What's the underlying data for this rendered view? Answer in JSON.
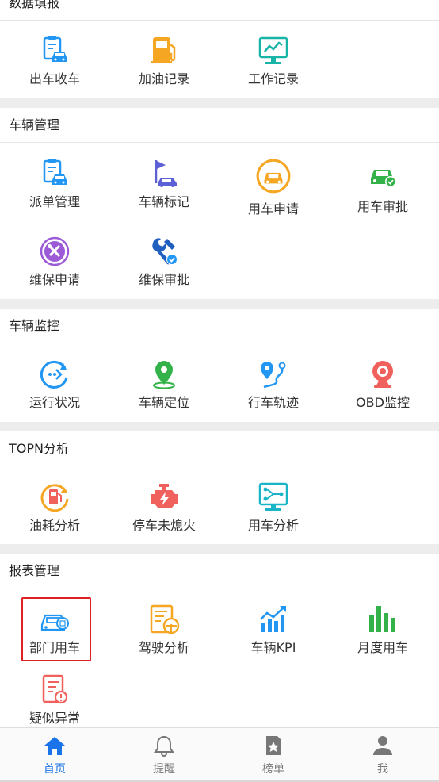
{
  "sections": [
    {
      "title": "数据填报",
      "items": [
        {
          "label": "出车收车",
          "icon": "car-clipboard-icon"
        },
        {
          "label": "加油记录",
          "icon": "fuel-pump-icon"
        },
        {
          "label": "工作记录",
          "icon": "monitor-chart-icon"
        }
      ]
    },
    {
      "title": "车辆管理",
      "items": [
        {
          "label": "派单管理",
          "icon": "car-clipboard-icon"
        },
        {
          "label": "车辆标记",
          "icon": "car-flag-icon"
        },
        {
          "label": "用车申请",
          "icon": "car-circle-icon"
        },
        {
          "label": "用车审批",
          "icon": "car-check-icon"
        },
        {
          "label": "维保申请",
          "icon": "tools-circle-icon"
        },
        {
          "label": "维保审批",
          "icon": "wrench-check-icon"
        }
      ]
    },
    {
      "title": "车辆监控",
      "items": [
        {
          "label": "运行状况",
          "icon": "status-circle-icon"
        },
        {
          "label": "车辆定位",
          "icon": "location-pin-icon"
        },
        {
          "label": "行车轨迹",
          "icon": "route-track-icon"
        },
        {
          "label": "OBD监控",
          "icon": "obd-camera-icon"
        }
      ]
    },
    {
      "title": "TOPN分析",
      "items": [
        {
          "label": "油耗分析",
          "icon": "fuel-circle-icon"
        },
        {
          "label": "停车未熄火",
          "icon": "engine-warning-icon"
        },
        {
          "label": "用车分析",
          "icon": "network-board-icon"
        }
      ]
    },
    {
      "title": "报表管理",
      "items": [
        {
          "label": "部门用车",
          "icon": "department-car-icon"
        },
        {
          "label": "驾驶分析",
          "icon": "driving-report-icon"
        },
        {
          "label": "车辆KPI",
          "icon": "kpi-chart-icon"
        },
        {
          "label": "月度用车",
          "icon": "bar-chart-icon"
        },
        {
          "label": "疑似异常",
          "icon": "report-alert-icon"
        }
      ]
    }
  ],
  "tabbar": [
    {
      "label": "首页",
      "icon": "home-icon",
      "active": true
    },
    {
      "label": "提醒",
      "icon": "bell-icon",
      "active": false
    },
    {
      "label": "榜单",
      "icon": "ranking-icon",
      "active": false
    },
    {
      "label": "我",
      "icon": "user-icon",
      "active": false
    }
  ],
  "colors": {
    "active_tab": "#1a73e8",
    "section_gap": "#ededed",
    "highlight_border": "#e02020",
    "icon_blue": "#2196f3",
    "icon_orange": "#f5a623",
    "icon_teal": "#19b4a8",
    "icon_green": "#33b24a",
    "icon_purple": "#9c5ad6",
    "icon_red": "#f0605c"
  }
}
